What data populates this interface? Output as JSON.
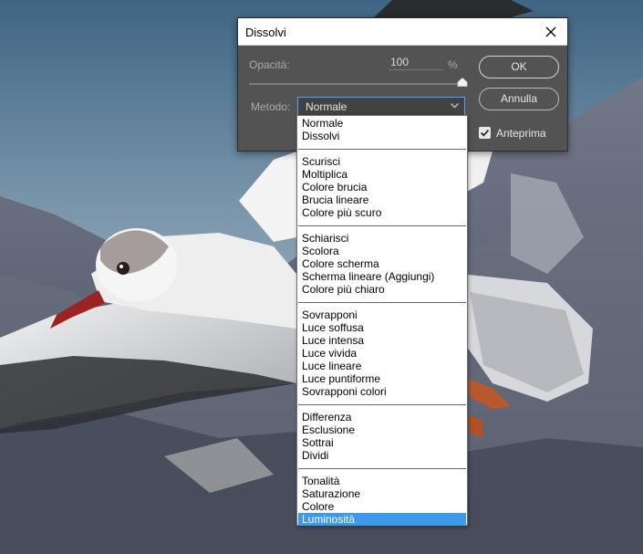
{
  "dialog": {
    "title": "Dissolvi",
    "opacity_label": "Opacità:",
    "opacity_value": "100",
    "opacity_unit": "%",
    "opacity_slider_value": 100,
    "method_label": "Metodo:",
    "method_value": "Normale",
    "ok_label": "OK",
    "cancel_label": "Annulla",
    "preview_label": "Anteprima",
    "preview_checked": true
  },
  "blend_modes": {
    "groups": [
      [
        "Normale",
        "Dissolvi"
      ],
      [
        "Scurisci",
        "Moltiplica",
        "Colore brucia",
        "Brucia lineare",
        "Colore più scuro"
      ],
      [
        "Schiarisci",
        "Scolora",
        "Colore scherma",
        "Scherma lineare (Aggiungi)",
        "Colore più chiaro"
      ],
      [
        "Sovrapponi",
        "Luce soffusa",
        "Luce intensa",
        "Luce vivida",
        "Luce lineare",
        "Luce puntiforme",
        "Sovrapponi colori"
      ],
      [
        "Differenza",
        "Esclusione",
        "Sottrai",
        "Dividi"
      ],
      [
        "Tonalità",
        "Saturazione",
        "Colore",
        "Luminosità"
      ]
    ],
    "highlighted": "Luminosità"
  },
  "colors": {
    "highlight": "#3d9ae8",
    "dialog_bg": "#535353",
    "focus_border": "#4aa3ff"
  }
}
